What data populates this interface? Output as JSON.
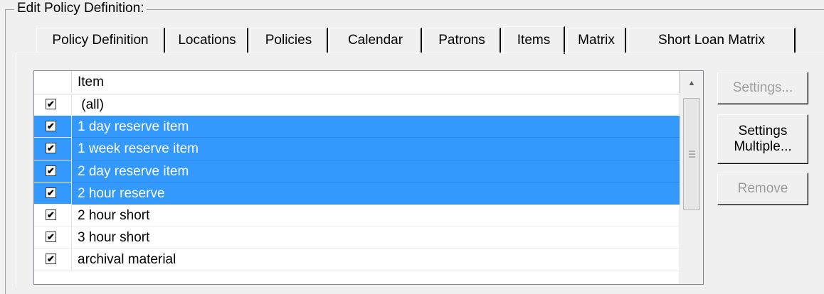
{
  "group": {
    "title": "Edit Policy Definition:"
  },
  "tabs": [
    {
      "label": "Policy Definition"
    },
    {
      "label": "Locations"
    },
    {
      "label": "Policies"
    },
    {
      "label": "Calendar"
    },
    {
      "label": "Patrons"
    },
    {
      "label": "Items"
    },
    {
      "label": "Matrix"
    },
    {
      "label": "Short Loan Matrix"
    }
  ],
  "active_tab": "Items",
  "list": {
    "column_header": "Item",
    "rows": [
      {
        "label": "(all)",
        "checked": true,
        "selected": false
      },
      {
        "label": "1 day reserve item",
        "checked": true,
        "selected": true
      },
      {
        "label": "1 week reserve item",
        "checked": true,
        "selected": true
      },
      {
        "label": "2 day reserve item",
        "checked": true,
        "selected": true
      },
      {
        "label": "2 hour reserve",
        "checked": true,
        "selected": true
      },
      {
        "label": "2 hour short",
        "checked": true,
        "selected": false
      },
      {
        "label": "3 hour short",
        "checked": true,
        "selected": false
      },
      {
        "label": "archival material",
        "checked": true,
        "selected": false
      }
    ],
    "scroll_up_icon": "triangle-up-icon",
    "grip_icon": "scroll-grip-icon"
  },
  "buttons": {
    "settings": "Settings...",
    "settings_multiple_line1": "Settings",
    "settings_multiple_line2": "Multiple...",
    "remove": "Remove"
  },
  "colors": {
    "selection": "#3399ff",
    "face": "#f0f0f0"
  }
}
